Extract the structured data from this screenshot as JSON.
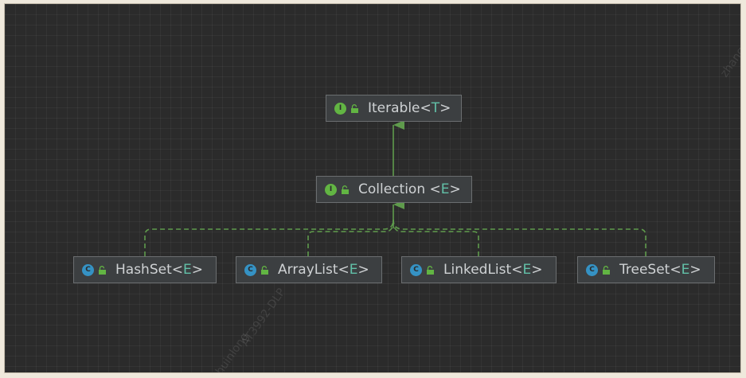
{
  "nodes": [
    {
      "id": "iterable",
      "kind": "interface",
      "badge": "I",
      "name": "Iterable",
      "lt": "<",
      "type_param": "T",
      "gt": ">"
    },
    {
      "id": "collection",
      "kind": "interface",
      "badge": "I",
      "name": "Collection ",
      "lt": "<",
      "type_param": "E",
      "gt": ">"
    },
    {
      "id": "hashset",
      "kind": "class",
      "badge": "C",
      "name": "HashSet",
      "lt": "<",
      "type_param": "E",
      "gt": ">"
    },
    {
      "id": "arraylist",
      "kind": "class",
      "badge": "C",
      "name": "ArrayList",
      "lt": "<",
      "type_param": "E",
      "gt": ">"
    },
    {
      "id": "linkedlist",
      "kind": "class",
      "badge": "C",
      "name": "LinkedList",
      "lt": "<",
      "type_param": "E",
      "gt": ">"
    },
    {
      "id": "treeset",
      "kind": "class",
      "badge": "C",
      "name": "TreeSet",
      "lt": "<",
      "type_param": "E",
      "gt": ">"
    }
  ],
  "edges": [
    {
      "from": "collection",
      "to": "iterable",
      "style": "extends"
    },
    {
      "from": "hashset",
      "to": "collection",
      "style": "implements"
    },
    {
      "from": "arraylist",
      "to": "collection",
      "style": "implements"
    },
    {
      "from": "linkedlist",
      "to": "collection",
      "style": "implements"
    },
    {
      "from": "treeset",
      "to": "collection",
      "style": "implements"
    }
  ],
  "watermarks": {
    "top_right": "zhangs",
    "bottom_left_a": "AT3992-DLP",
    "bottom_left_b": "huinlong"
  },
  "colors": {
    "background": "#2b2b2b",
    "edge": "#5f9b4c",
    "interface_badge": "#62b543",
    "class_badge": "#3592c4",
    "type_param": "#62c0a8"
  }
}
